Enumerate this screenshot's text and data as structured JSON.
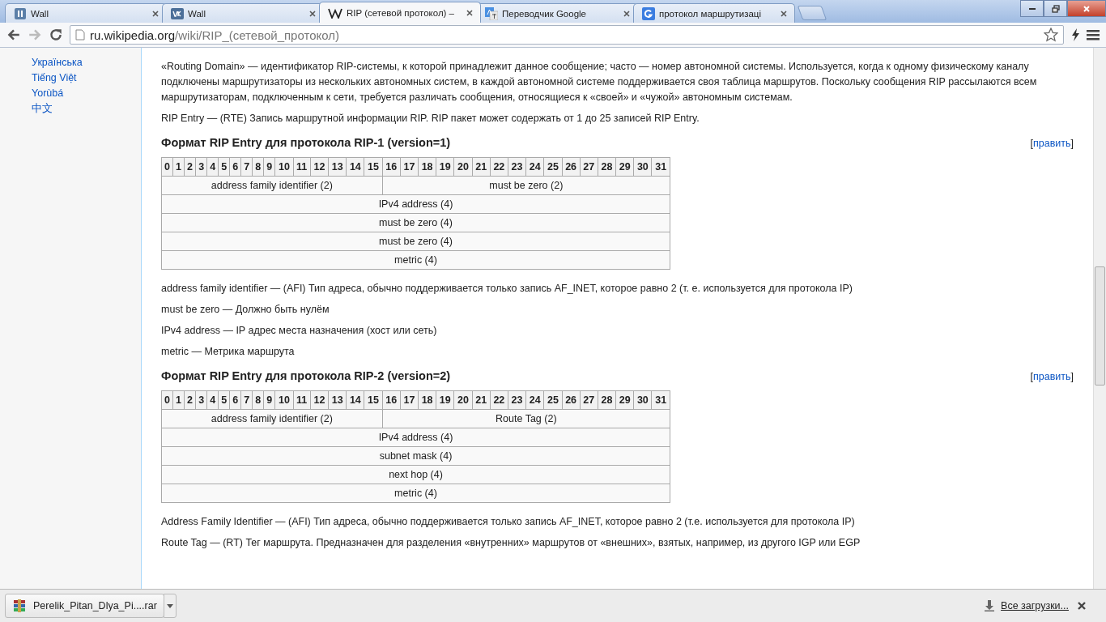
{
  "tabs": [
    {
      "title": "Wall",
      "selected": false
    },
    {
      "title": "Wall",
      "selected": false
    },
    {
      "title": "RIP (сетевой протокол) –",
      "selected": true
    },
    {
      "title": "Переводчик Google",
      "selected": false
    },
    {
      "title": "протокол маршрутизаці",
      "selected": false
    }
  ],
  "address_bar": {
    "host": "ru.wikipedia.org",
    "path": "/wiki/RIP_(сетевой_протокол)"
  },
  "sidebar": {
    "languages": [
      "Українська",
      "Tiếng Việt",
      "Yorùbá",
      "中文"
    ]
  },
  "article": [
    {
      "kind": "paragraph",
      "text": "«Routing Domain» — идентификатор RIP-системы, к которой принадлежит данное сообщение; часто — номер автономной системы. Используется, когда к одному физическому каналу подключены маршрутизаторы из нескольких автономных систем, в каждой автономной системе поддерживается своя таблица маршрутов. Поскольку сообщения RIP рассылаются всем маршрутизаторам, подключенным к сети, требуется различать сообщения, относящиеся к «своей» и «чужой» автономным системам."
    },
    {
      "kind": "paragraph",
      "text": "RIP Entry — (RTE) Запись маршрутной информации RIP. RIP пакет может содержать от 1 до 25 записей RIP Entry."
    },
    {
      "kind": "heading",
      "text": "Формат RIP Entry для протокола RIP-1 (version=1)",
      "edit_before": "[",
      "edit_link": "править",
      "edit_after": "]"
    },
    {
      "kind": "table",
      "bits": [
        "0",
        "1",
        "2",
        "3",
        "4",
        "5",
        "6",
        "7",
        "8",
        "9",
        "10",
        "11",
        "12",
        "13",
        "14",
        "15",
        "16",
        "17",
        "18",
        "19",
        "20",
        "21",
        "22",
        "23",
        "24",
        "25",
        "26",
        "27",
        "28",
        "29",
        "30",
        "31"
      ],
      "rows": [
        [
          {
            "text": "address family identifier (2)",
            "colspan": 16
          },
          {
            "text": "must be zero (2)",
            "colspan": 16
          }
        ],
        [
          {
            "text": "IPv4 address (4)",
            "colspan": 32
          }
        ],
        [
          {
            "text": "must be zero (4)",
            "colspan": 32
          }
        ],
        [
          {
            "text": "must be zero (4)",
            "colspan": 32
          }
        ],
        [
          {
            "text": "metric (4)",
            "colspan": 32
          }
        ]
      ]
    },
    {
      "kind": "paragraph",
      "text": "address family identifier — (AFI) Тип адреса, обычно поддерживается только запись AF_INET, которое равно 2 (т. е. используется для протокола IP)"
    },
    {
      "kind": "paragraph",
      "text": "must be zero — Должно быть нулём"
    },
    {
      "kind": "paragraph",
      "text": "IPv4 address — IP адрес места назначения (хост или сеть)"
    },
    {
      "kind": "paragraph",
      "text": "metric — Метрика маршрута"
    },
    {
      "kind": "heading",
      "text": "Формат RIP Entry для протокола RIP-2 (version=2)",
      "edit_before": "[",
      "edit_link": "править",
      "edit_after": "]"
    },
    {
      "kind": "table",
      "bits": [
        "0",
        "1",
        "2",
        "3",
        "4",
        "5",
        "6",
        "7",
        "8",
        "9",
        "10",
        "11",
        "12",
        "13",
        "14",
        "15",
        "16",
        "17",
        "18",
        "19",
        "20",
        "21",
        "22",
        "23",
        "24",
        "25",
        "26",
        "27",
        "28",
        "29",
        "30",
        "31"
      ],
      "rows": [
        [
          {
            "text": "address family identifier (2)",
            "colspan": 16
          },
          {
            "text": "Route Tag (2)",
            "colspan": 16
          }
        ],
        [
          {
            "text": "IPv4 address (4)",
            "colspan": 32
          }
        ],
        [
          {
            "text": "subnet mask (4)",
            "colspan": 32
          }
        ],
        [
          {
            "text": "next hop (4)",
            "colspan": 32
          }
        ],
        [
          {
            "text": "metric (4)",
            "colspan": 32
          }
        ]
      ]
    },
    {
      "kind": "paragraph",
      "text": "Address Family Identifier — (AFI) Тип адреса, обычно поддерживается только запись AF_INET, которое равно 2 (т.е. используется для протокола IP)"
    },
    {
      "kind": "paragraph",
      "text": "Route Tag — (RT) Тег маршрута. Предназначен для разделения «внутренних» маршрутов от «внешних», взятых, например, из другого IGP или EGP"
    }
  ],
  "download_bar": {
    "file": "Perelik_Pitan_Dlya_Pi....rar",
    "all_downloads": "Все загрузки..."
  }
}
